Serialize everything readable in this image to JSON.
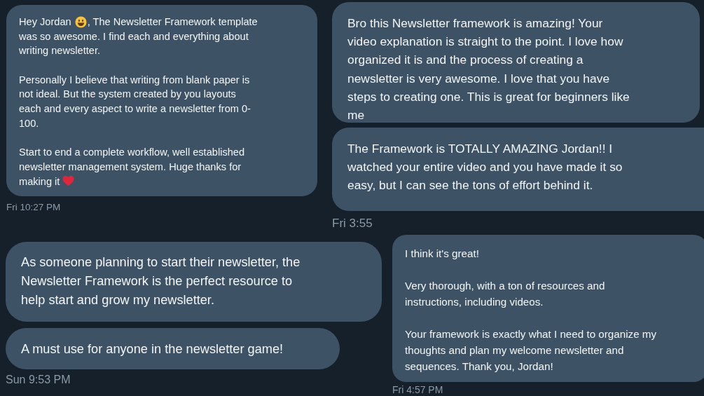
{
  "panels": [
    {
      "messages": [
        {
          "paragraphs": [
            [
              [
                {
                  "kind": "text",
                  "text": "Hey Jordan"
                },
                {
                  "kind": "smiley"
                },
                {
                  "kind": "text",
                  "text": ", The Newsletter Framework template"
                }
              ],
              [
                {
                  "kind": "text",
                  "text": "was so awesome. I find each and everything about"
                }
              ],
              [
                {
                  "kind": "text",
                  "text": "writing newsletter."
                }
              ]
            ],
            [
              [
                {
                  "kind": "text",
                  "text": "Personally I believe that writing from blank paper is"
                }
              ],
              [
                {
                  "kind": "text",
                  "text": "not ideal. But the system created by you layouts"
                }
              ],
              [
                {
                  "kind": "text",
                  "text": "each and every aspect to write a newsletter from 0-"
                }
              ],
              [
                {
                  "kind": "text",
                  "text": "100."
                }
              ]
            ],
            [
              [
                {
                  "kind": "text",
                  "text": "Start to end a complete workflow, well established"
                }
              ],
              [
                {
                  "kind": "text",
                  "text": "newsletter management system. Huge thanks for"
                }
              ],
              [
                {
                  "kind": "text",
                  "text": "making it"
                },
                {
                  "kind": "heart"
                }
              ]
            ]
          ]
        }
      ],
      "timestamp": "Fri 10:27 PM"
    },
    {
      "messages": [
        {
          "paragraphs": [
            [
              [
                {
                  "kind": "text",
                  "text": "Bro this Newsletter framework is amazing! Your"
                }
              ],
              [
                {
                  "kind": "text",
                  "text": "video explanation is straight to the point. I love how"
                }
              ],
              [
                {
                  "kind": "text",
                  "text": "organized it is and the process of creating a"
                }
              ],
              [
                {
                  "kind": "text",
                  "text": "newsletter is very awesome. I love that you have"
                }
              ],
              [
                {
                  "kind": "text",
                  "text": "steps to creating one. This is great for beginners like"
                }
              ],
              [
                {
                  "kind": "text",
                  "text": "me"
                }
              ]
            ]
          ]
        },
        {
          "paragraphs": [
            [
              [
                {
                  "kind": "text",
                  "text": "The Framework is TOTALLY AMAZING Jordan!! I"
                }
              ],
              [
                {
                  "kind": "text",
                  "text": "watched your entire video and you have made it so"
                }
              ],
              [
                {
                  "kind": "text",
                  "text": "easy, but I can see the tons of effort behind it."
                }
              ]
            ]
          ]
        }
      ],
      "timestamp": "Fri 3:55"
    },
    {
      "messages": [
        {
          "paragraphs": [
            [
              [
                {
                  "kind": "text",
                  "text": "As someone planning to start their newsletter, the"
                }
              ],
              [
                {
                  "kind": "text",
                  "text": "Newsletter Framework is the perfect resource to"
                }
              ],
              [
                {
                  "kind": "text",
                  "text": "help start and grow my newsletter."
                }
              ]
            ]
          ]
        },
        {
          "paragraphs": [
            [
              [
                {
                  "kind": "text",
                  "text": "A must use for anyone in the newsletter game!"
                }
              ]
            ]
          ]
        }
      ],
      "timestamp": "Sun 9:53 PM"
    },
    {
      "messages": [
        {
          "paragraphs": [
            [
              [
                {
                  "kind": "text",
                  "text": "I think it's great!"
                }
              ]
            ],
            [
              [
                {
                  "kind": "text",
                  "text": "Very thorough, with a ton of resources and"
                }
              ],
              [
                {
                  "kind": "text",
                  "text": "instructions, including videos."
                }
              ]
            ],
            [
              [
                {
                  "kind": "text",
                  "text": "Your framework is exactly what I need to organize my"
                }
              ],
              [
                {
                  "kind": "text",
                  "text": "thoughts and plan my welcome newsletter and"
                }
              ],
              [
                {
                  "kind": "text",
                  "text": "sequences. Thank you, Jordan!"
                }
              ]
            ]
          ]
        }
      ],
      "timestamp": "Fri 4:57 PM"
    }
  ]
}
